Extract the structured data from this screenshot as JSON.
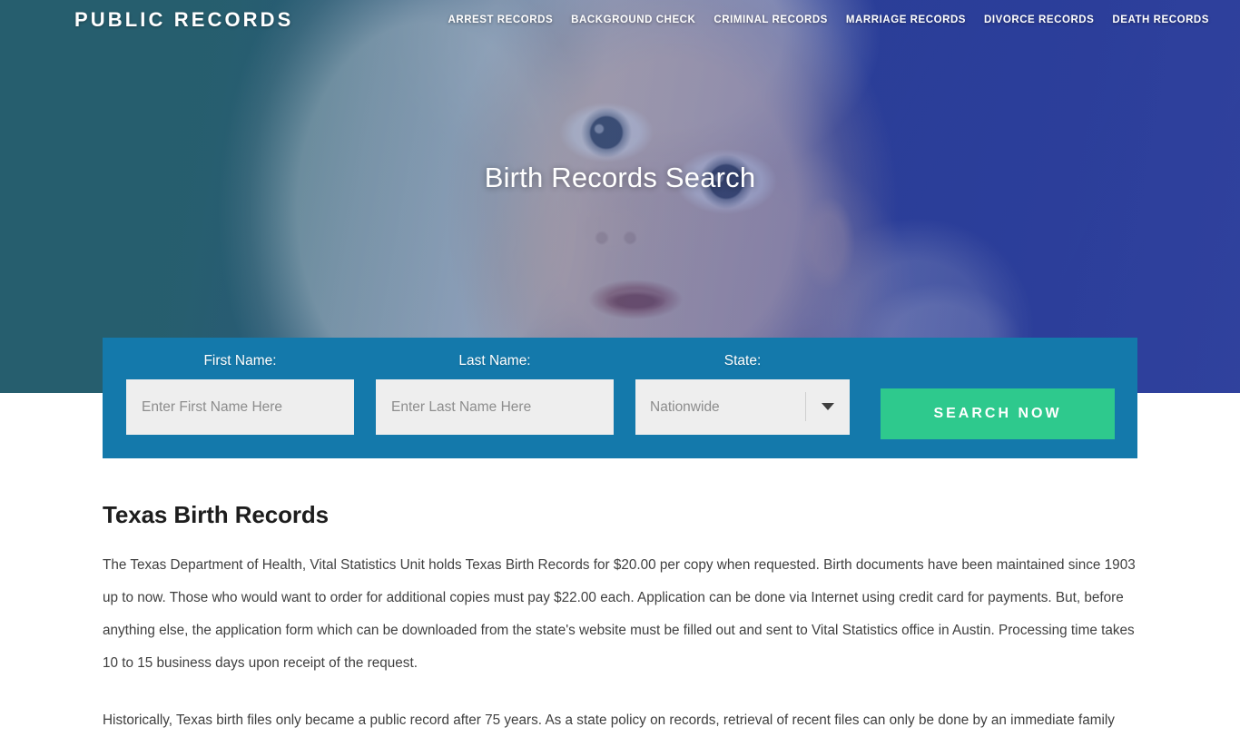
{
  "header": {
    "brand": "PUBLIC RECORDS",
    "nav": [
      {
        "label": "ARREST RECORDS"
      },
      {
        "label": "BACKGROUND CHECK"
      },
      {
        "label": "CRIMINAL RECORDS"
      },
      {
        "label": "MARRIAGE RECORDS"
      },
      {
        "label": "DIVORCE RECORDS"
      },
      {
        "label": "DEATH RECORDS"
      }
    ]
  },
  "hero": {
    "title": "Birth Records Search"
  },
  "search_form": {
    "first_name": {
      "label": "First Name:",
      "placeholder": "Enter First Name Here",
      "value": ""
    },
    "last_name": {
      "label": "Last Name:",
      "placeholder": "Enter Last Name Here",
      "value": ""
    },
    "state": {
      "label": "State:",
      "selected": "Nationwide",
      "icon": "chevron-down-icon"
    },
    "submit_label": "SEARCH NOW"
  },
  "article": {
    "title": "Texas Birth Records",
    "paragraph_1": "The Texas Department of Health, Vital Statistics Unit holds Texas Birth Records for $20.00 per copy when requested. Birth documents have been maintained since 1903 up to now. Those who would want to order for additional copies must pay $22.00 each. Application can be done via Internet using credit card for payments. But, before anything else, the application form which can be downloaded from the state's website must be filled out and sent to Vital Statistics office in Austin. Processing time takes 10 to 15 business days upon receipt of the request.",
    "paragraph_2": "Historically, Texas birth files only became a public record after 75 years. As a state policy on records, retrieval of recent files can only be done by an immediate family"
  },
  "colors": {
    "hero_left": "#285f6e",
    "hero_right": "#2c3f9b",
    "panel": "#1479ab",
    "accent_green": "#2ec98d",
    "input_bg": "#eeeeee"
  }
}
